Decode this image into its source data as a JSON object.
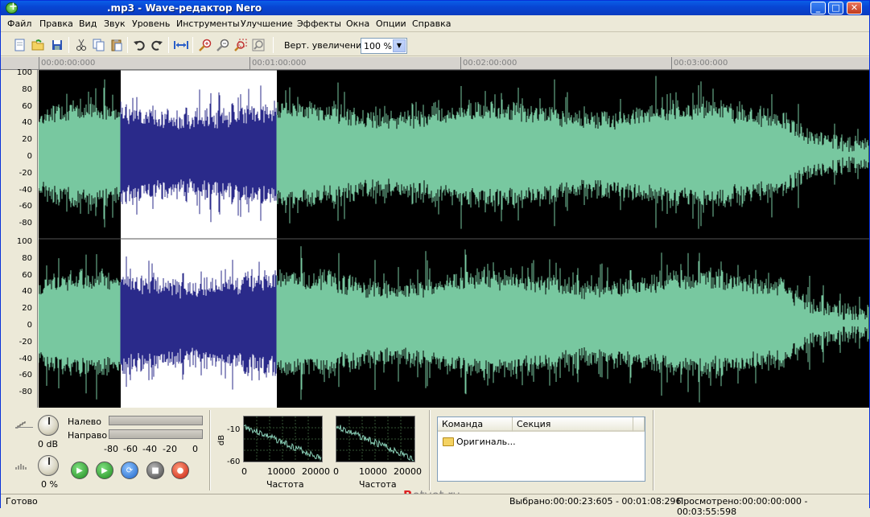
{
  "window": {
    "title": ".mp3 - Wave-редактор Nero",
    "min_label": "_",
    "max_label": "□",
    "close_label": "✕"
  },
  "menu": [
    "Файл",
    "Правка",
    "Вид",
    "Звук",
    "Уровень",
    "Инструменты",
    "Улучшение",
    "Эффекты",
    "Окна",
    "Опции",
    "Справка"
  ],
  "toolbar": {
    "vzoom_label": "Верт. увеличение",
    "vzoom_value": "100 %",
    "icons": [
      "new-file-icon",
      "open-folder-icon",
      "save-icon",
      "cut-icon",
      "copy-icon",
      "paste-icon",
      "undo-icon",
      "redo-icon",
      "fit-width-icon",
      "zoom-in-icon",
      "zoom-out-icon",
      "zoom-selection-icon",
      "zoom-full-icon"
    ]
  },
  "timeline": [
    "00:00:00:000",
    "00:01:00:000",
    "00:02:00:000",
    "00:03:00:000"
  ],
  "scale_labels": [
    "100",
    "80",
    "60",
    "40",
    "20",
    "0",
    "-20",
    "-40",
    "-60",
    "-80"
  ],
  "waveform": {
    "wave_color": "#78c8a0",
    "selection_color": "#2a2a8a",
    "selection_bg": "#ffffff",
    "bg": "#000000"
  },
  "levels": {
    "gain_value": "0 dB",
    "pan_value": "0 %",
    "left_label": "Налево",
    "right_label": "Направо",
    "meter_ticks": [
      "-80",
      "-60",
      "-40",
      "-20",
      "0"
    ]
  },
  "transport": [
    {
      "name": "play-button",
      "icon": "play-icon",
      "color": "#2e9b2e",
      "glyph": "▶"
    },
    {
      "name": "play-selection-button",
      "icon": "play-selection-icon",
      "color": "#2e9b2e",
      "glyph": "▶"
    },
    {
      "name": "loop-button",
      "icon": "loop-icon",
      "color": "#2a7fd4",
      "glyph": "⟳"
    },
    {
      "name": "stop-button",
      "icon": "stop-icon",
      "color": "#555555",
      "glyph": "■"
    },
    {
      "name": "record-button",
      "icon": "record-icon",
      "color": "#d62a18",
      "glyph": "●"
    }
  ],
  "spectrum": {
    "y_label": "dB",
    "y_ticks": [
      "-10",
      "-60"
    ],
    "x_ticks": [
      "0",
      "10000",
      "20000"
    ],
    "x_label": "Частота"
  },
  "history": {
    "col_command": "Команда",
    "col_section": "Секция",
    "items": [
      "Оригиналь..."
    ]
  },
  "status": {
    "ready": "Готово",
    "selected": "Выбрано:00:00:23:605 - 00:01:08:296",
    "viewed": "Просмотрено:00:00:00:000 - 00:03:55:598"
  },
  "watermark": {
    "b": "B",
    "rest": "otvet.ru"
  }
}
